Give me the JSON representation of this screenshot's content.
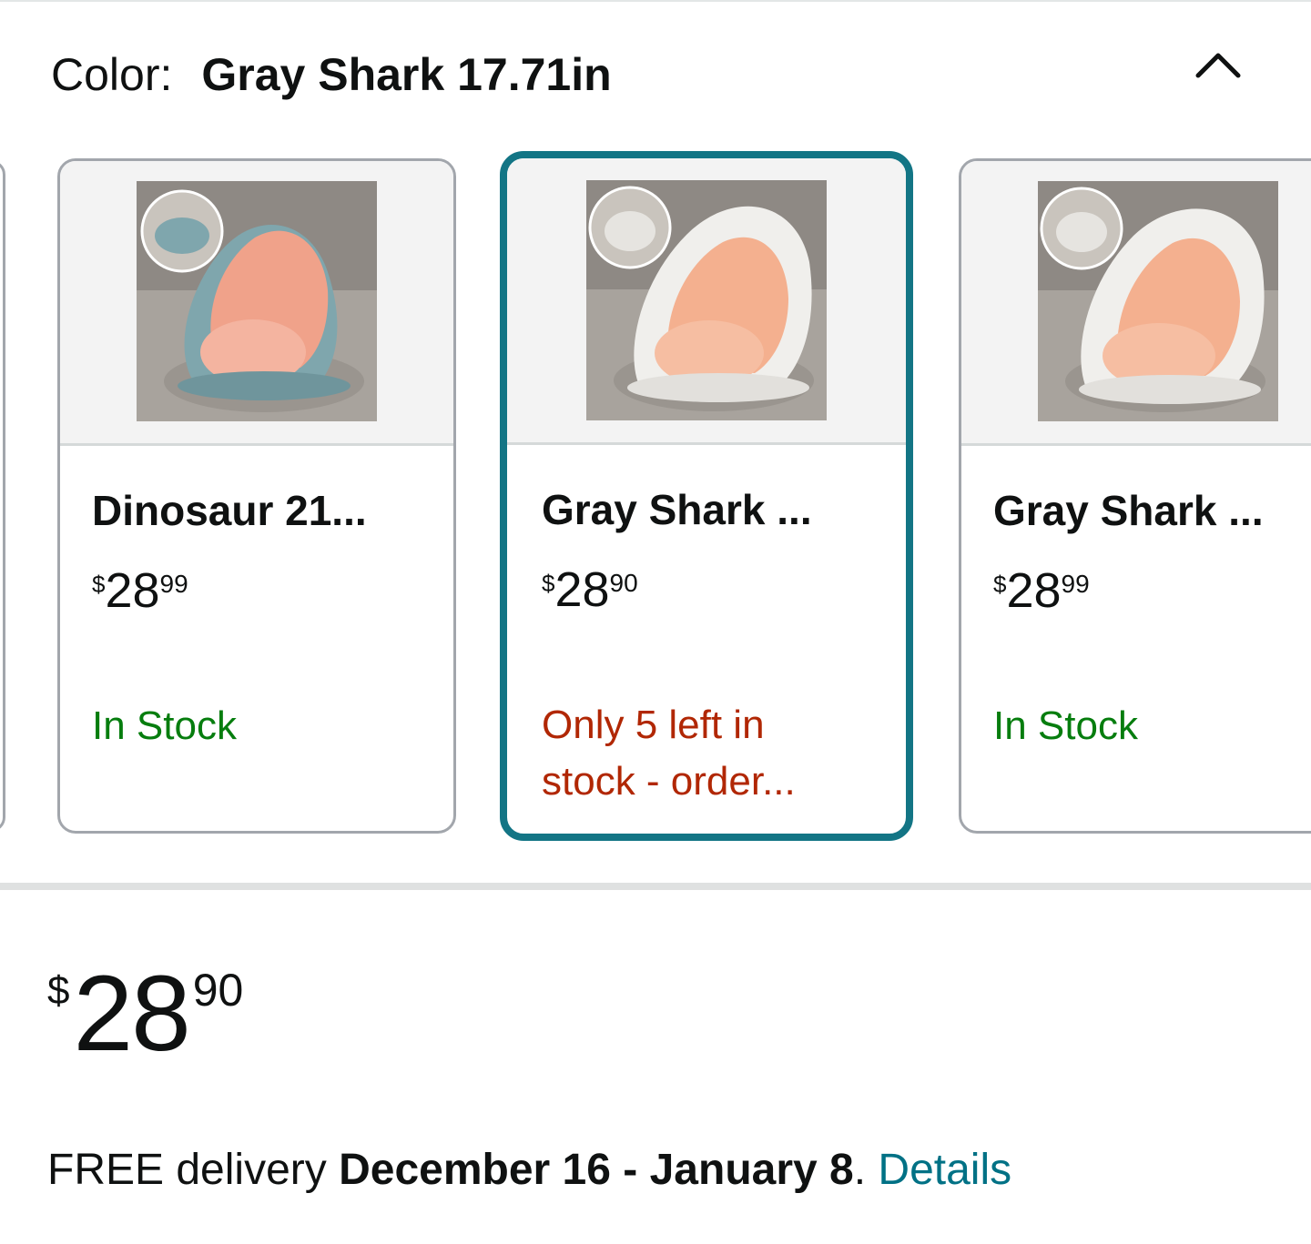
{
  "variation": {
    "label": "Color:",
    "selected_value": "Gray Shark 17.71in"
  },
  "swatches": [
    {
      "title": "Dinosaur 21...",
      "price": {
        "currency": "$",
        "whole": "28",
        "fraction": "99"
      },
      "availability_line1": "In Stock",
      "availability_line2": "",
      "availability_color": "#067d0e",
      "body_color": "#7fa6ad",
      "selected": false
    },
    {
      "title": "Gray Shark ...",
      "price": {
        "currency": "$",
        "whole": "28",
        "fraction": "90"
      },
      "availability_line1": "Only 5 left in",
      "availability_line2": "stock - order...",
      "availability_color": "#b12704",
      "body_color": "#f0efec",
      "selected": true
    },
    {
      "title": "Gray Shark ...",
      "price": {
        "currency": "$",
        "whole": "28",
        "fraction": "99"
      },
      "availability_line1": "In Stock",
      "availability_line2": "",
      "availability_color": "#067d0e",
      "body_color": "#f0efec",
      "selected": false
    }
  ],
  "price": {
    "currency": "$",
    "whole": "28",
    "fraction": "90"
  },
  "delivery": {
    "prefix": "FREE delivery ",
    "dates": "December 16 - January 8",
    "period": ". ",
    "link": "Details"
  },
  "colors": {
    "selected_border": "#137585",
    "in_stock": "#067d0e",
    "low_stock": "#b12704",
    "link": "#007185"
  },
  "icons": {
    "collapse": "chevron-up-icon"
  }
}
